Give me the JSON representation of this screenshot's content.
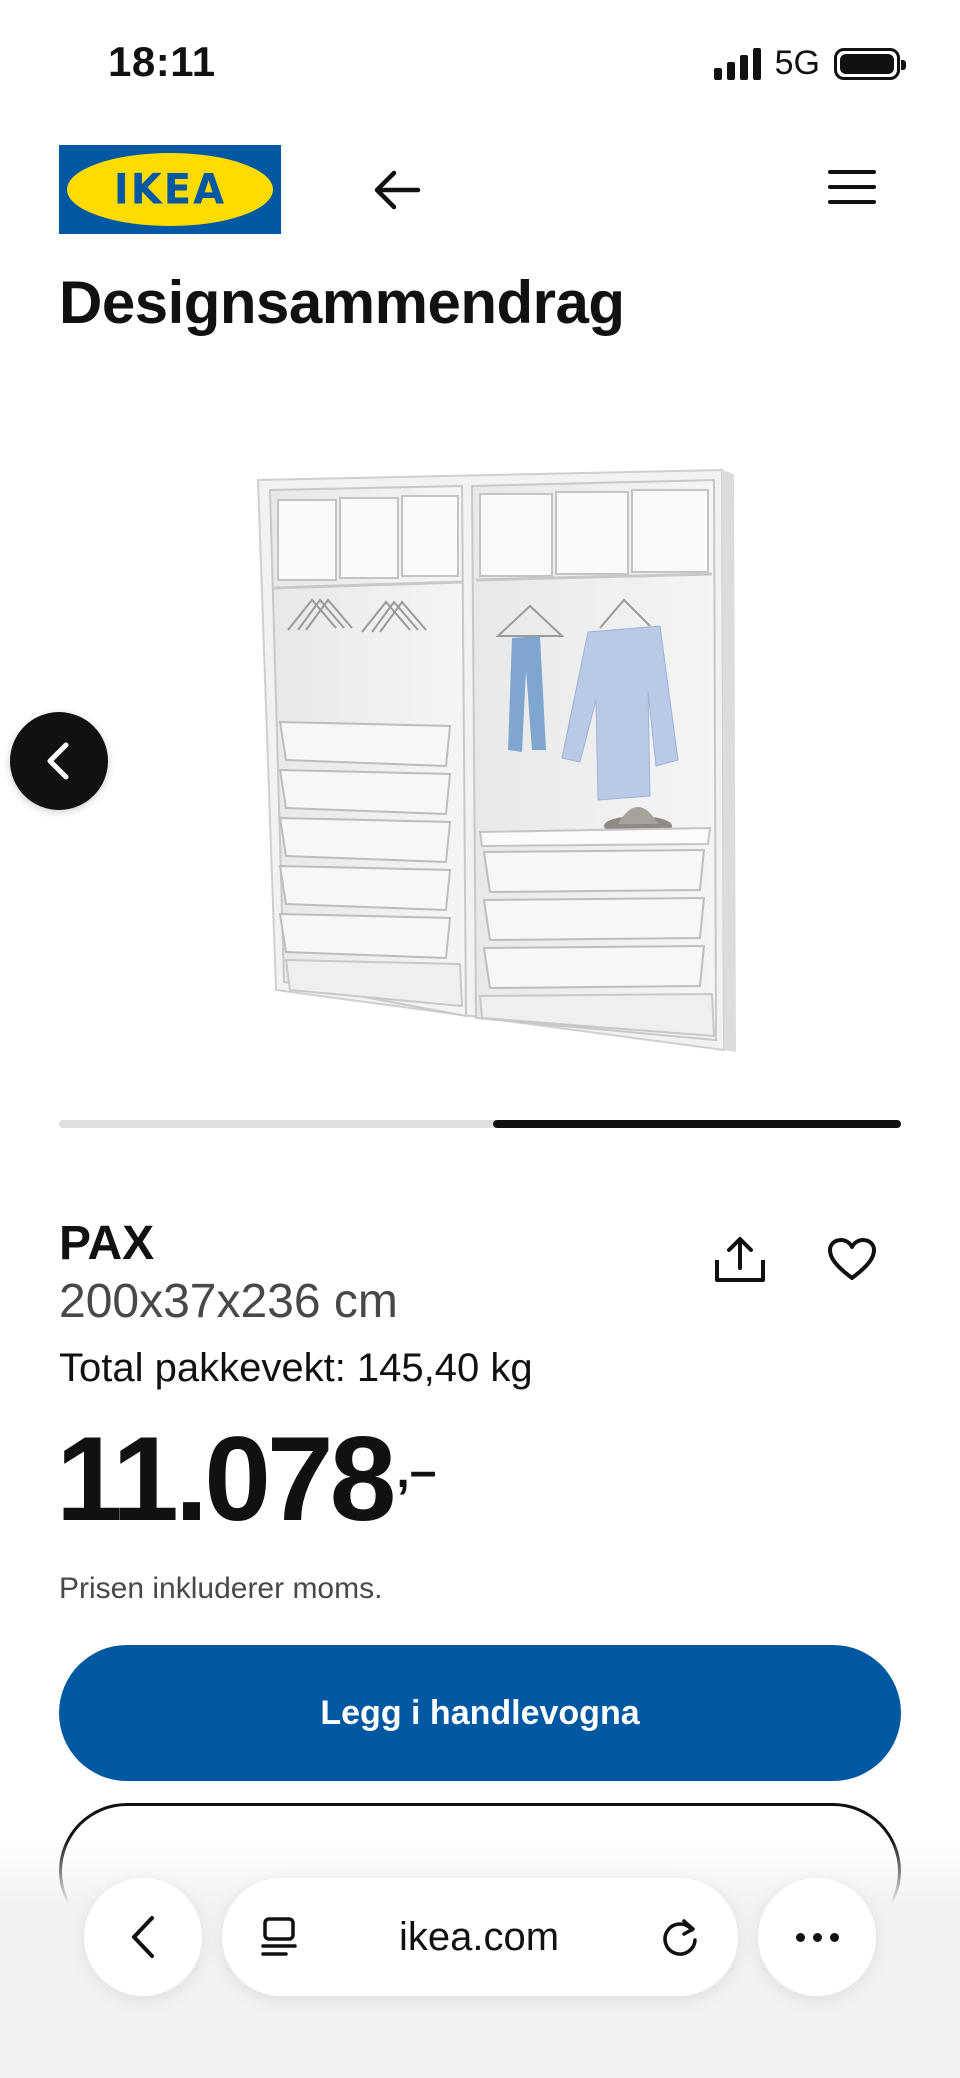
{
  "status_bar": {
    "time": "18:11",
    "network": "5G"
  },
  "header": {
    "logo_text": "IKEA",
    "back_icon": "arrow-left-icon",
    "menu_icon": "hamburger-menu-icon"
  },
  "page": {
    "title": "Designsammendrag"
  },
  "gallery": {
    "image_alt": "PAX wardrobe design",
    "prev_icon": "chevron-left-icon",
    "progress_start": 0.515,
    "progress_end": 1.0
  },
  "product": {
    "name": "PAX",
    "dimensions": "200x37x236 cm",
    "weight": "Total pakkevekt: 145,40 kg",
    "price_main": "11.078",
    "price_suffix": ",–",
    "price_note": "Prisen inkluderer moms.",
    "share_icon": "share-icon",
    "favourite_icon": "heart-icon"
  },
  "actions": {
    "add_to_cart": "Legg i handlevogna"
  },
  "browser": {
    "url": "ikea.com",
    "back_icon": "chevron-left-icon",
    "tabs_icon": "reader-icon",
    "reload_icon": "reload-icon",
    "more_icon": "ellipsis-icon"
  },
  "colors": {
    "brand_blue": "#0058a3",
    "brand_yellow": "#ffdb00",
    "text": "#111111",
    "muted": "#484848"
  }
}
